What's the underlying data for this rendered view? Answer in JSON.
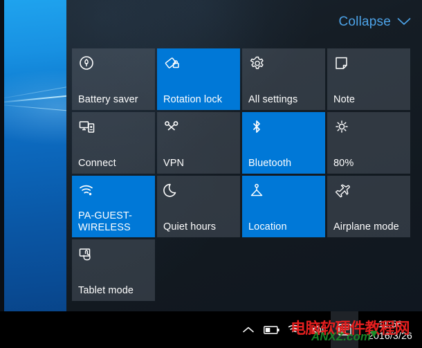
{
  "desktop": {
    "wallpaper_name": "windows-10-hero-blue",
    "colors": {
      "top": "#1fa3ee",
      "bottom": "#073670"
    }
  },
  "action_center": {
    "collapse": {
      "label": "Collapse",
      "chevron_icon": "chevron-down-icon"
    },
    "colors": {
      "panel_bg": "#131a21",
      "tile_on": "#0078d7",
      "tile_off": "rgba(118,130,142,0.30)",
      "accent_link": "#4da3e8"
    },
    "tiles": [
      {
        "label": "Battery saver",
        "icon": "battery-saver-icon",
        "state": "off",
        "two_line": false
      },
      {
        "label": "Rotation lock",
        "icon": "rotation-lock-icon",
        "state": "on",
        "two_line": false
      },
      {
        "label": "All settings",
        "icon": "gear-icon",
        "state": "off",
        "two_line": false
      },
      {
        "label": "Note",
        "icon": "note-icon",
        "state": "off",
        "two_line": false
      },
      {
        "label": "Connect",
        "icon": "connect-icon",
        "state": "off",
        "two_line": false
      },
      {
        "label": "VPN",
        "icon": "vpn-icon",
        "state": "off",
        "two_line": false
      },
      {
        "label": "Bluetooth",
        "icon": "bluetooth-icon",
        "state": "on",
        "two_line": false
      },
      {
        "label": "80%",
        "icon": "brightness-icon",
        "state": "off",
        "two_line": false
      },
      {
        "label": "PA-GUEST-\nWIRELESS",
        "icon": "wifi-icon",
        "state": "on",
        "two_line": true
      },
      {
        "label": "Quiet hours",
        "icon": "moon-icon",
        "state": "off",
        "two_line": false
      },
      {
        "label": "Location",
        "icon": "location-icon",
        "state": "on",
        "two_line": false
      },
      {
        "label": "Airplane mode",
        "icon": "airplane-icon",
        "state": "off",
        "two_line": false
      },
      {
        "label": "Tablet mode",
        "icon": "tablet-mode-icon",
        "state": "off",
        "two_line": false
      }
    ]
  },
  "taskbar": {
    "tray_icons": [
      {
        "name": "show-hidden-icons-chevron-icon"
      },
      {
        "name": "battery-icon"
      },
      {
        "name": "wifi-icon"
      },
      {
        "name": "speaker-icon"
      },
      {
        "name": "action-center-icon"
      }
    ],
    "clock": {
      "time": "11:56",
      "date": "2016/3/26"
    }
  },
  "watermark": {
    "chinese_text": "电脑软硬件教程网",
    "latin_text": "ANXZ.com"
  }
}
